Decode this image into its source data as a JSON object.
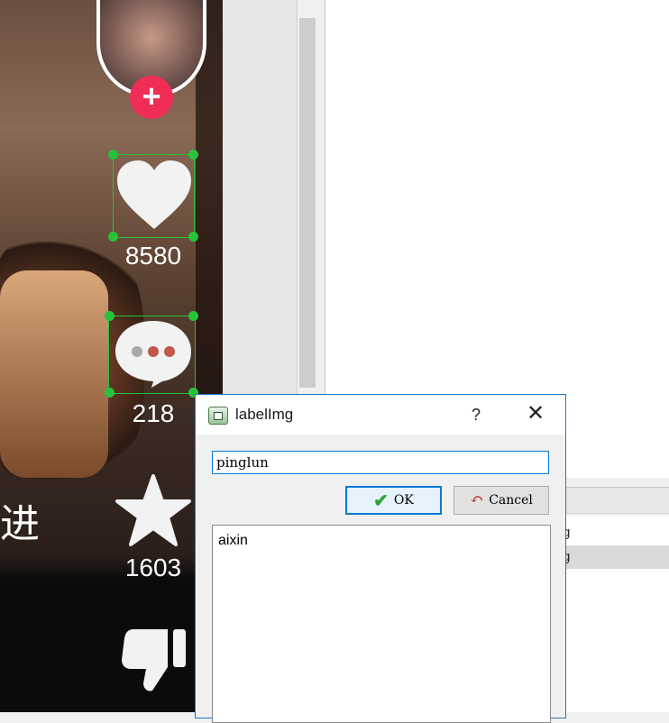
{
  "video": {
    "overlay_text": "进",
    "actions": [
      {
        "name": "like",
        "icon": "heart-icon",
        "count": "8580"
      },
      {
        "name": "comment",
        "icon": "comment-bubble-icon",
        "count": "218"
      },
      {
        "name": "favorite",
        "icon": "star-icon",
        "count": "1603"
      },
      {
        "name": "dislike",
        "icon": "thumbs-down-icon",
        "count": ""
      }
    ],
    "avatar_plus": "+"
  },
  "right_list": {
    "rows": [
      "g",
      "g"
    ]
  },
  "dialog": {
    "title": "labelImg",
    "help": "?",
    "close": "✕",
    "input_value": "pinglun",
    "ok_label": "OK",
    "cancel_label": "Cancel",
    "labels": [
      "aixin"
    ]
  },
  "colors": {
    "bbox": "#27c23a",
    "accent": "#0a78d7",
    "plus": "#f02d55"
  }
}
